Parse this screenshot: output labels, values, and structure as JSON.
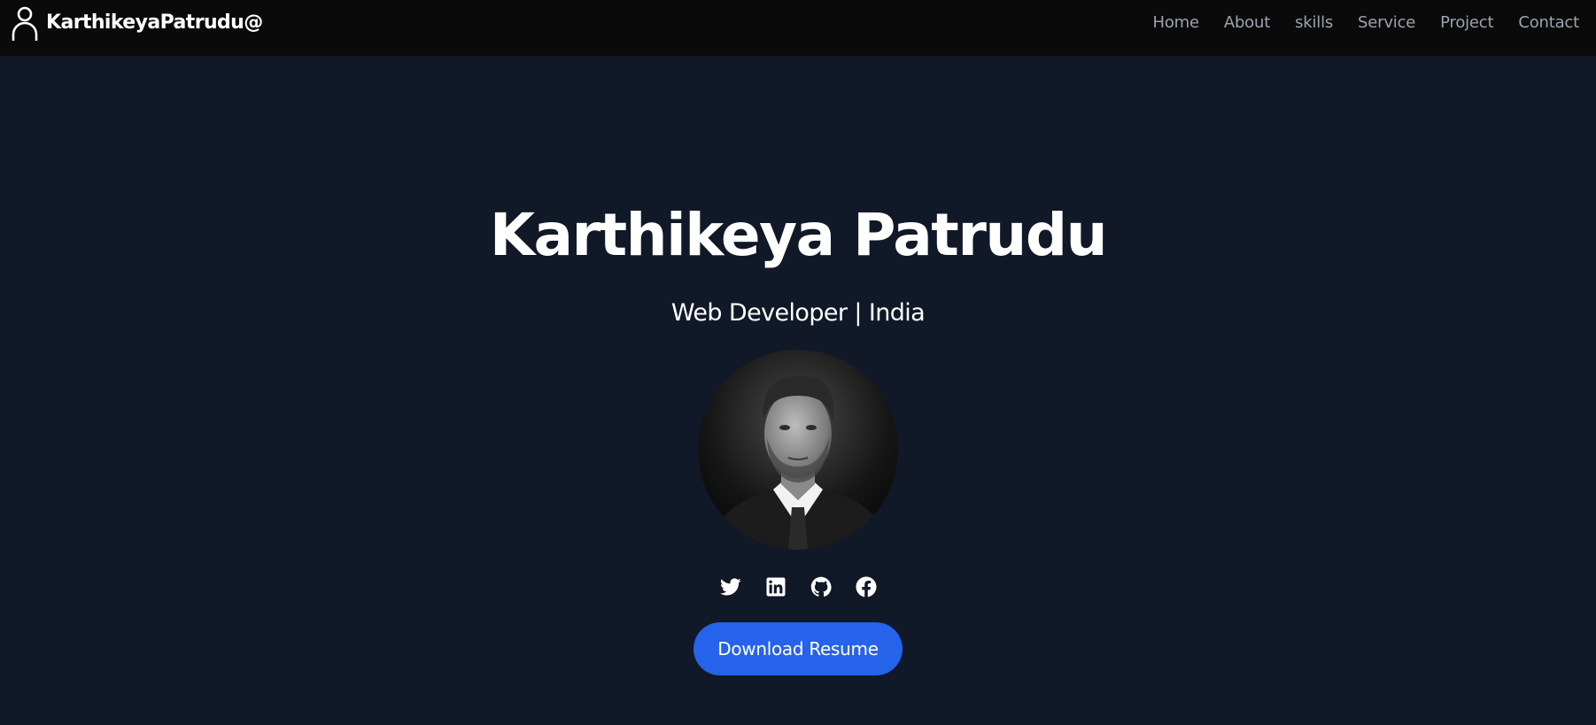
{
  "navbar": {
    "brand_label": "KarthikeyaPatrudu@",
    "brand_icon": "user-icon",
    "links": [
      {
        "label": "Home"
      },
      {
        "label": "About"
      },
      {
        "label": "skills"
      },
      {
        "label": "Service"
      },
      {
        "label": "Project"
      },
      {
        "label": "Contact"
      }
    ]
  },
  "hero": {
    "title": "Karthikeya Patrudu",
    "subtitle": "Web Developer | India",
    "avatar_icon": "profile-photo",
    "socials": [
      {
        "icon": "twitter-icon"
      },
      {
        "icon": "linkedin-icon"
      },
      {
        "icon": "github-icon"
      },
      {
        "icon": "facebook-icon"
      }
    ],
    "resume_button_label": "Download Resume"
  },
  "colors": {
    "navbar_bg": "#0a0a0a",
    "page_bg": "#111827",
    "nav_link": "#9ca3af",
    "accent": "#2563eb",
    "text": "#ffffff"
  }
}
